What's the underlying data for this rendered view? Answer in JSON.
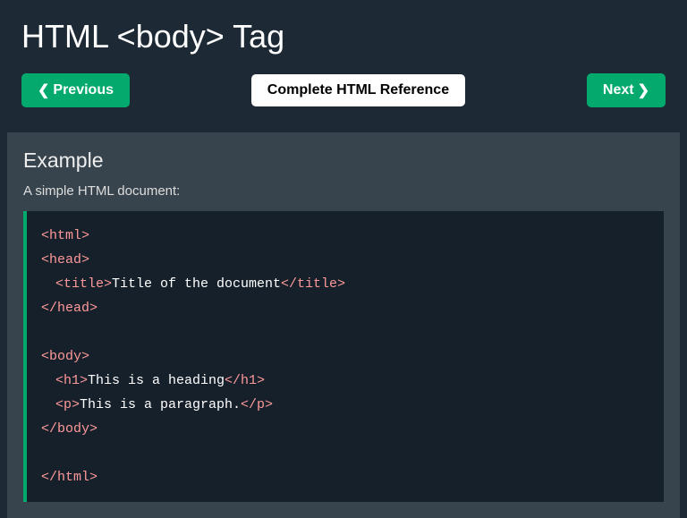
{
  "title": "HTML <body> Tag",
  "nav": {
    "previous": "Previous",
    "reference": "Complete HTML Reference",
    "next": "Next"
  },
  "example": {
    "heading": "Example",
    "description": "A simple HTML document:",
    "code": {
      "html_open": "<html>",
      "head_open": "<head>",
      "title_open": "<title>",
      "title_text": "Title of the document",
      "title_close": "</title>",
      "head_close": "</head>",
      "body_open": "<body>",
      "h1_open": "<h1>",
      "h1_text": "This is a heading",
      "h1_close": "</h1>",
      "p_open": "<p>",
      "p_text": "This is a paragraph.",
      "p_close": "</p>",
      "body_close": "</body>",
      "html_close": "</html>"
    }
  }
}
